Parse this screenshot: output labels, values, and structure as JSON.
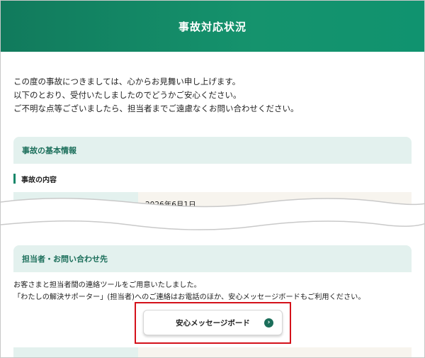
{
  "header": {
    "title": "事故対応状況"
  },
  "intro": {
    "lines": [
      "この度の事故につきましては、心からお見舞い申し上げます。",
      "以下のとおり、受付いたしましたのでどうかご安心ください。",
      "ご不明な点等ございましたら、担当者までご遠慮なくお問い合わせください。"
    ]
  },
  "accident_info": {
    "title": "事故の基本情報",
    "subtitle": "事故の内容",
    "row_value_partial": "2026年6月1日"
  },
  "contact": {
    "title": "担当者・お問い合わせ先",
    "lines": [
      "お客さまと担当者間の連絡ツールをご用意いたしました。",
      "「わたしの解決サポーター」(担当者)へのご連絡はお電話のほか、安心メッセージボードもご利用ください。"
    ],
    "button_label": "安心メッセージボード"
  },
  "colors": {
    "header_green": "#15936d",
    "section_bg": "#e3f1ee",
    "section_text": "#1b6e5a",
    "highlight_red": "#d4111a"
  },
  "icons": {
    "button_arrow": "chevron-right-circle-icon"
  }
}
